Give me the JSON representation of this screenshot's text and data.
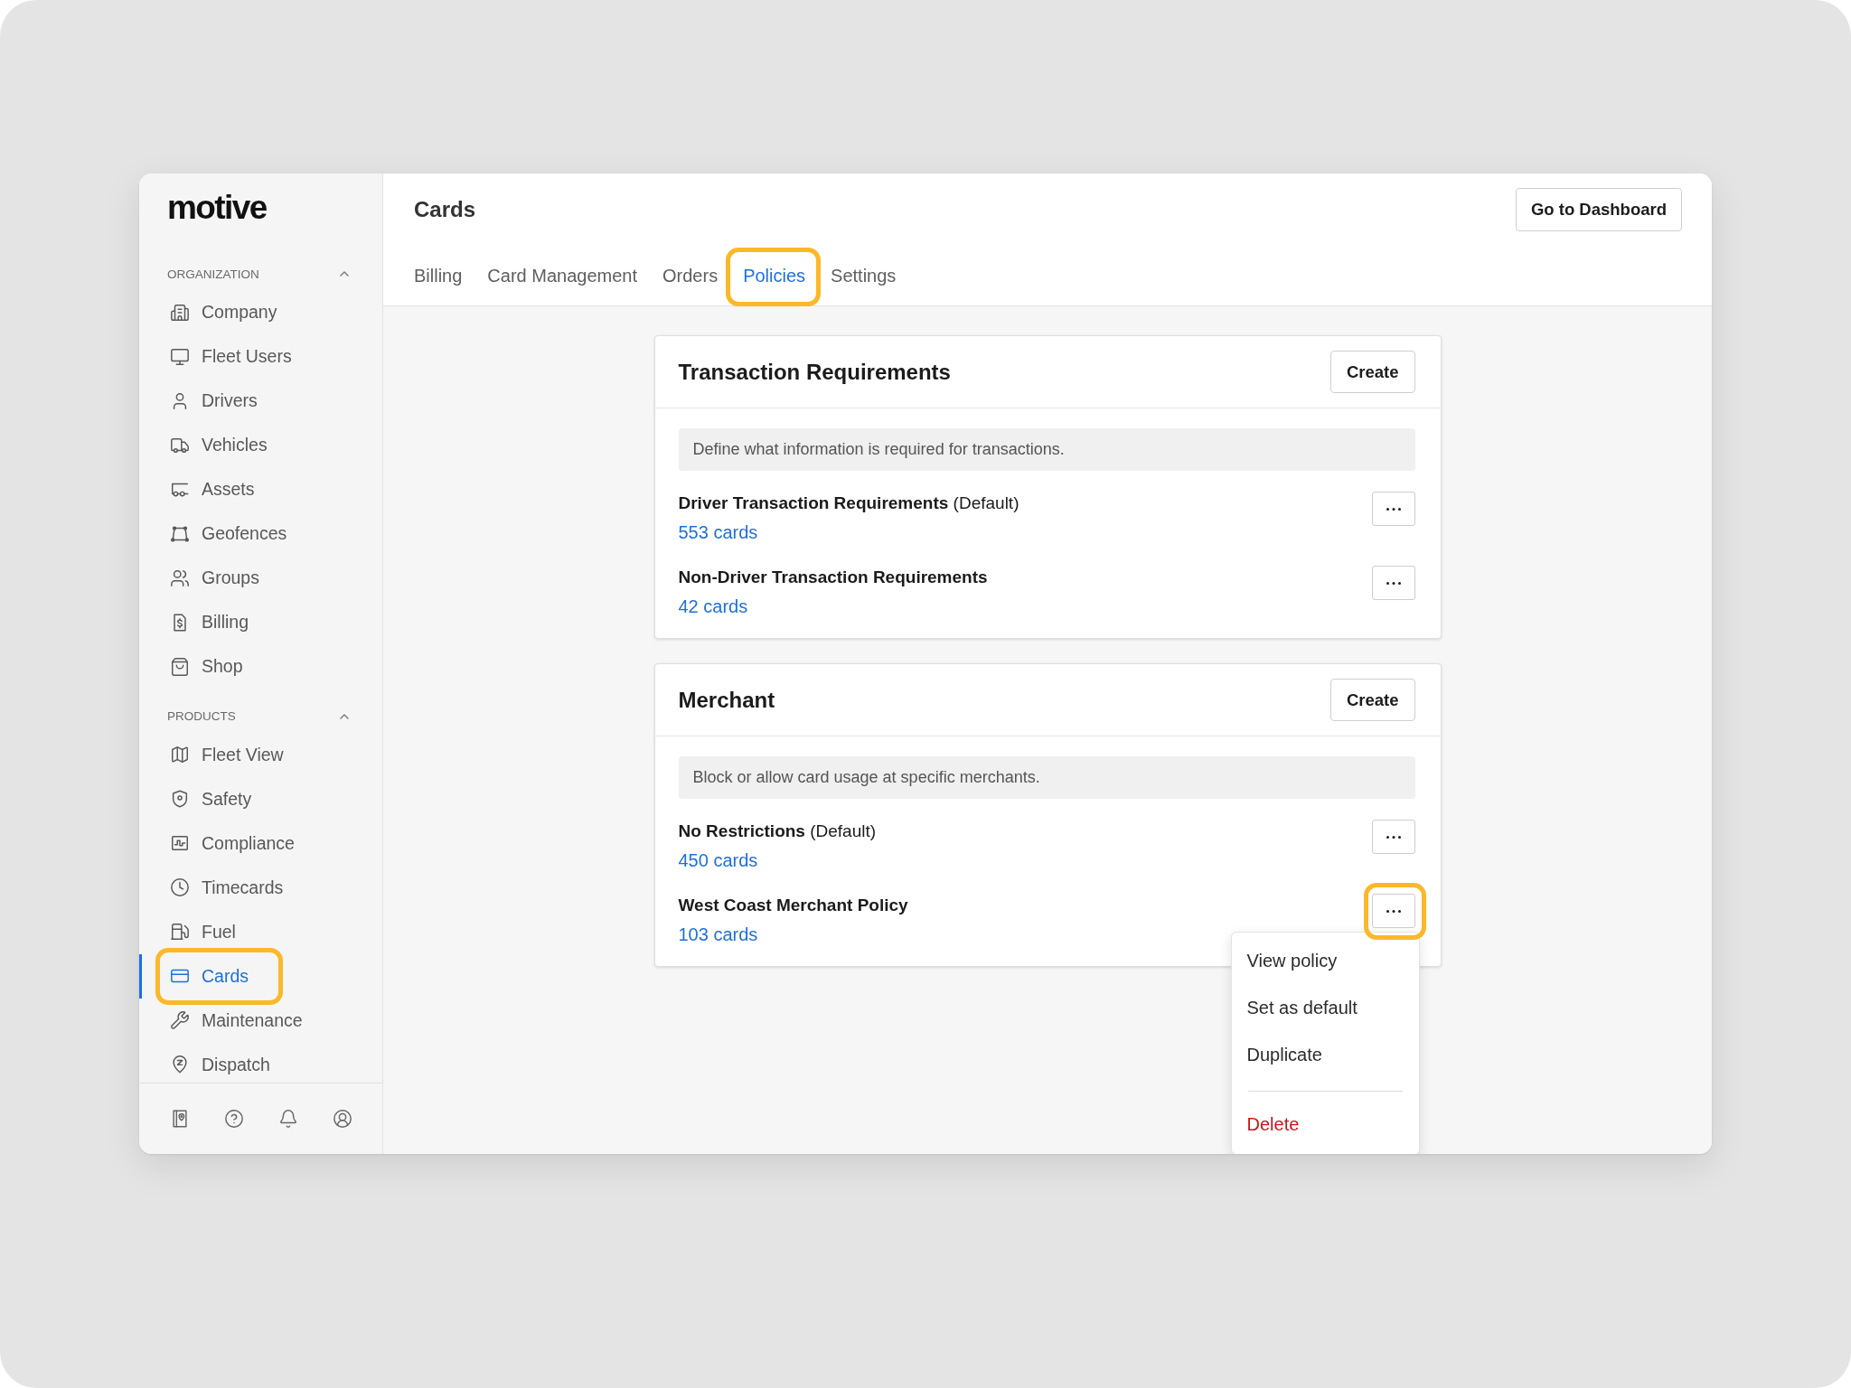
{
  "logo": {
    "text": "motive"
  },
  "sidebar": {
    "sections": [
      {
        "title": "ORGANIZATION",
        "expanded": true,
        "items": [
          {
            "label": "Company",
            "selected": false,
            "highlighted": false
          },
          {
            "label": "Fleet Users",
            "selected": false,
            "highlighted": false
          },
          {
            "label": "Drivers",
            "selected": false,
            "highlighted": false
          },
          {
            "label": "Vehicles",
            "selected": false,
            "highlighted": false
          },
          {
            "label": "Assets",
            "selected": false,
            "highlighted": false
          },
          {
            "label": "Geofences",
            "selected": false,
            "highlighted": false
          },
          {
            "label": "Groups",
            "selected": false,
            "highlighted": false
          },
          {
            "label": "Billing",
            "selected": false,
            "highlighted": false
          },
          {
            "label": "Shop",
            "selected": false,
            "highlighted": false
          }
        ]
      },
      {
        "title": "PRODUCTS",
        "expanded": true,
        "items": [
          {
            "label": "Fleet View",
            "selected": false,
            "highlighted": false
          },
          {
            "label": "Safety",
            "selected": false,
            "highlighted": false
          },
          {
            "label": "Compliance",
            "selected": false,
            "highlighted": false
          },
          {
            "label": "Timecards",
            "selected": false,
            "highlighted": false
          },
          {
            "label": "Fuel",
            "selected": false,
            "highlighted": false
          },
          {
            "label": "Cards",
            "selected": true,
            "highlighted": true
          },
          {
            "label": "Maintenance",
            "selected": false,
            "highlighted": false
          },
          {
            "label": "Dispatch",
            "selected": false,
            "highlighted": false
          }
        ]
      }
    ]
  },
  "header": {
    "title": "Cards",
    "button": "Go to Dashboard",
    "tabs": [
      {
        "label": "Billing",
        "selected": false,
        "highlighted": false
      },
      {
        "label": "Card Management",
        "selected": false,
        "highlighted": false
      },
      {
        "label": "Orders",
        "selected": false,
        "highlighted": false
      },
      {
        "label": "Policies",
        "selected": true,
        "highlighted": true
      },
      {
        "label": "Settings",
        "selected": false,
        "highlighted": false
      }
    ]
  },
  "policy_groups": [
    {
      "title": "Transaction Requirements",
      "button": "Create",
      "description": "Define what information is required for transactions.",
      "policies": [
        {
          "name": "Driver Transaction Requirements",
          "tag": "(Default)",
          "cards": "553 cards",
          "highlighted": false
        },
        {
          "name": "Non-Driver Transaction Requirements",
          "cards": "42 cards",
          "highlighted": false
        }
      ]
    },
    {
      "title": "Merchant",
      "button": "Create",
      "description": "Block or allow card usage at specific merchants.",
      "policies": [
        {
          "name": "No Restrictions",
          "tag": "(Default)",
          "cards": "450 cards",
          "highlighted": false
        },
        {
          "name": "West Coast Merchant Policy",
          "cards": "103 cards",
          "highlighted": true,
          "menu": {
            "groups": [
              {
                "items": [
                  {
                    "label": "View policy",
                    "kind": "normal"
                  },
                  {
                    "label": "Set as default",
                    "kind": "normal"
                  },
                  {
                    "label": "Duplicate",
                    "kind": "normal"
                  }
                ]
              },
              {
                "items": [
                  {
                    "label": "Delete",
                    "kind": "danger"
                  }
                ]
              }
            ]
          }
        }
      ]
    }
  ]
}
